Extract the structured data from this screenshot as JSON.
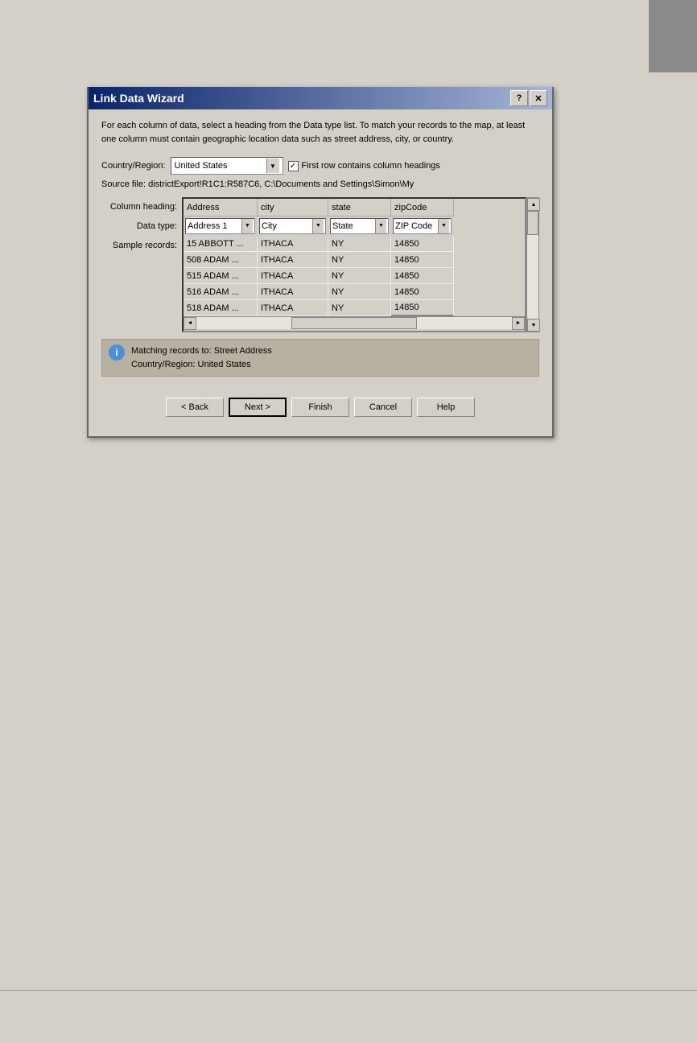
{
  "page": {
    "background": "#d4d0c8"
  },
  "dialog": {
    "title": "Link Data Wizard",
    "help_btn": "?",
    "close_btn": "✕",
    "description": "For each column of data, select a heading from the Data type list. To match your records to the map, at least one column must contain geographic location data such as street address, city, or country.",
    "country_label": "Country/Region:",
    "country_value": "United States",
    "first_row_label": "First row contains column headings",
    "source_label": "Source file:",
    "source_value": "districtExport!R1C1:R587C6, C:\\Documents and Settings\\Simon\\My",
    "column_heading_label": "Column heading:",
    "data_type_label": "Data type:",
    "sample_records_label": "Sample records:",
    "columns": [
      {
        "heading": "Address",
        "data_type": "Address 1"
      },
      {
        "heading": "city",
        "data_type": "City"
      },
      {
        "heading": "state",
        "data_type": "State"
      },
      {
        "heading": "zipCode",
        "data_type": "ZIP Code"
      }
    ],
    "sample_rows": [
      [
        "15  ABBOTT ...",
        "ITHACA",
        "NY",
        "14850"
      ],
      [
        "508  ADAM ...",
        "ITHACA",
        "NY",
        "14850"
      ],
      [
        "515  ADAM ...",
        "ITHACA",
        "NY",
        "14850"
      ],
      [
        "516  ADAM ...",
        "ITHACA",
        "NY",
        "14850"
      ],
      [
        "518  ADAM ...",
        "ITHACA",
        "NY",
        "14850"
      ]
    ],
    "info_message_line1": "Matching records to: Street Address",
    "info_message_line2": "Country/Region: United States",
    "back_btn": "< Back",
    "next_btn": "Next >",
    "finish_btn": "Finish",
    "cancel_btn": "Cancel",
    "help_btn2": "Help"
  }
}
